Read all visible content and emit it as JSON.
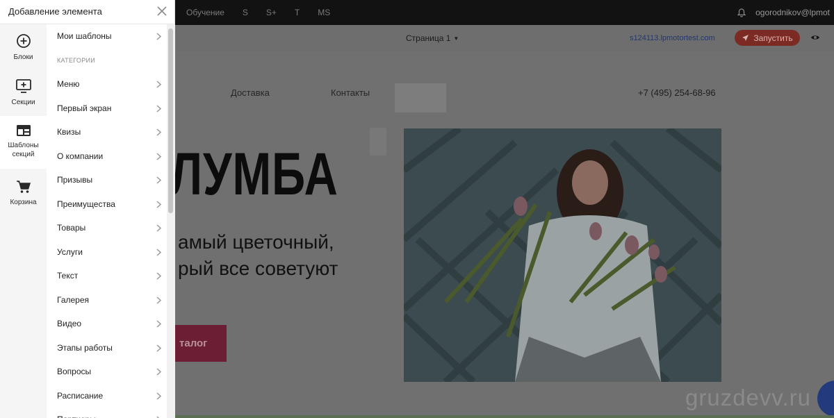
{
  "topbar": {
    "nav": [
      "Обучение",
      "S",
      "S+",
      "T",
      "MS"
    ],
    "user_email": "ogorodnikov@lpmot"
  },
  "toolbar": {
    "page_label": "Страница 1",
    "domain": "s124113.lpmotortest.com",
    "launch_label": "Запустить"
  },
  "site": {
    "nav_delivery": "Доставка",
    "nav_contacts": "Контакты",
    "phone": "+7 (495) 254-68-96",
    "hero_title": "ЛУМБА",
    "hero_sub_1": "амый цветочный,",
    "hero_sub_2": "рый все советуют",
    "hero_button": "талог"
  },
  "panel": {
    "title": "Добавление элемента",
    "rail": [
      {
        "label": "Блоки",
        "icon": "plus-circle-icon"
      },
      {
        "label": "Секции",
        "icon": "monitor-plus-icon"
      },
      {
        "label": "Шаблоны секций",
        "icon": "template-icon"
      },
      {
        "label": "Корзина",
        "icon": "cart-icon"
      }
    ],
    "my_templates": "Мои шаблоны",
    "categories_header": "КАТЕГОРИИ",
    "categories": [
      "Меню",
      "Первый экран",
      "Квизы",
      "О компании",
      "Призывы",
      "Преимущества",
      "Товары",
      "Услуги",
      "Текст",
      "Галерея",
      "Видео",
      "Этапы работы",
      "Вопросы",
      "Расписание",
      "Партнеры"
    ]
  },
  "watermark": "gruzdevv.ru",
  "colors": {
    "accent_red": "#e8453c",
    "brand_pink": "#d1315b",
    "link_blue": "#3a5db8",
    "overlay": "#6f6f6f"
  }
}
